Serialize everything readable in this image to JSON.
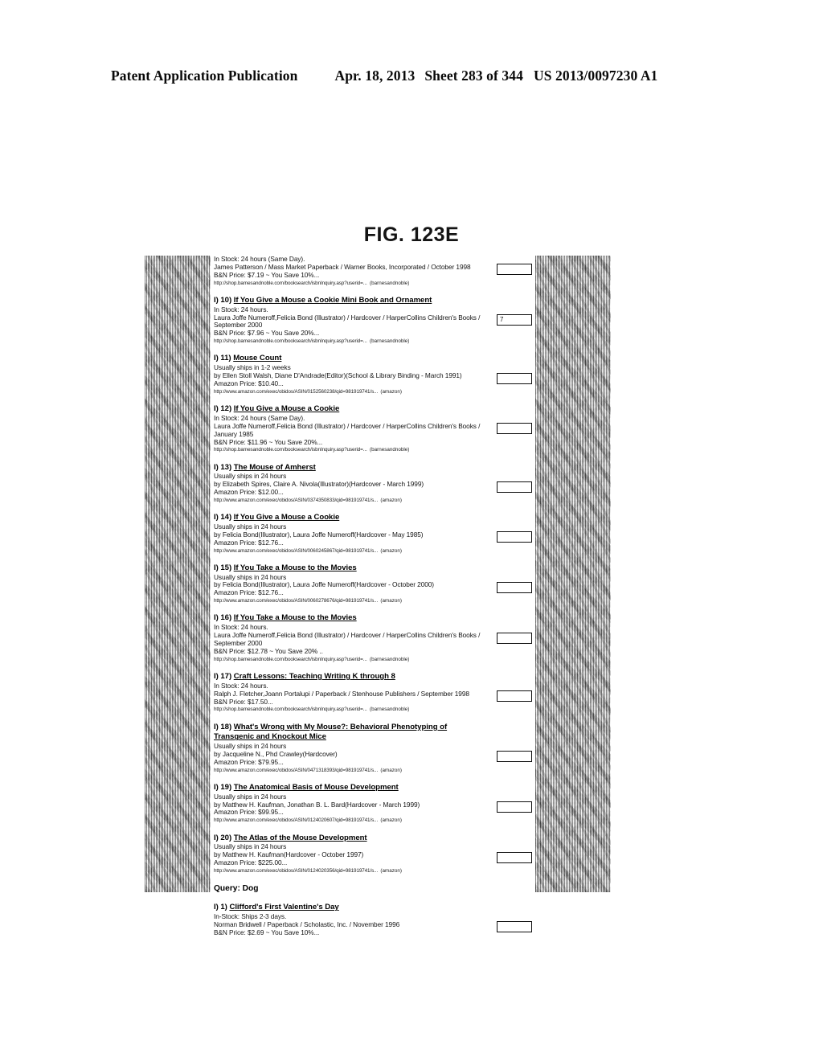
{
  "header": {
    "publication": "Patent Application Publication",
    "date": "Apr. 18, 2013",
    "sheet": "Sheet 283 of 344",
    "patent_number": "US 2013/0097230 A1"
  },
  "figure": {
    "caption": "FIG. 123E",
    "partial_top_entry": {
      "stock": "In Stock: 24 hours (Same Day).",
      "detail": "James Patterson / Mass Market Paperback / Warner Books, Incorporated / October 1998",
      "price": "B&N Price: $7.19 ~ You Save 10%...",
      "url": "http://shop.barnesandnoble.com/booksearch/isbnInquiry.asp?userid=...",
      "source": "(barnesandnoble)"
    },
    "entries": [
      {
        "num": "I) 10)",
        "title": "If You Give a Mouse a Cookie Mini Book and Ornament",
        "stock": "In Stock: 24 hours.",
        "detail": "Laura Joffe Numeroff,Felicia Bond (Illustrator) / Hardcover / HarperCollins Children's Books /",
        "detail2": "September 2000",
        "price": "B&N Price: $7.96 ~ You Save 20%...",
        "url": "http://shop.barnesandnoble.com/booksearch/isbnInquiry.asp?userid=...",
        "source": "(barnesandnoble)",
        "box_label": "7"
      },
      {
        "num": "I) 11)",
        "title": "Mouse Count",
        "stock": "Usually ships in 1-2 weeks",
        "detail": "by Ellen Stoll Walsh, Diane D'Andrade(Editor)(School & Library Binding - March 1991)",
        "price": "Amazon Price: $10.40...",
        "url": "http://www.amazon.com/exec/obidos/ASIN/0152560238/qid=981919741/s...",
        "source": "(amazon)",
        "box_label": ""
      },
      {
        "num": "I) 12)",
        "title": "If You Give a Mouse a Cookie",
        "stock": "In Stock: 24 hours (Same Day).",
        "detail": "Laura Joffe Numeroff,Felicia Bond (Illustrator) / Hardcover / HarperCollins Children's Books /",
        "detail2": "January 1985",
        "price": "B&N Price: $11.96 ~ You Save 20%...",
        "url": "http://shop.barnesandnoble.com/booksearch/isbnInquiry.asp?userid=...",
        "source": "(barnesandnoble)",
        "box_label": ""
      },
      {
        "num": "I) 13)",
        "title": "The Mouse of Amherst",
        "stock": "Usually ships in 24 hours",
        "detail": "by Elizabeth Spires, Claire A. Nivola(Illustrator)(Hardcover - March 1999)",
        "price": "Amazon Price: $12.00...",
        "url": "http://www.amazon.com/exec/obidos/ASIN/0374350833/qid=981919741/s...",
        "source": "(amazon)",
        "box_label": ""
      },
      {
        "num": "I) 14)",
        "title": "If You Give a Mouse a Cookie",
        "stock": "Usually ships in 24 hours",
        "detail": "by Felicia Bond(Illustrator), Laura Joffe Numeroff(Hardcover - May 1985)",
        "price": "Amazon Price: $12.76...",
        "url": "http://www.amazon.com/exec/obidos/ASIN/0060245867/qid=981919741/s...",
        "source": "(amazon)",
        "box_label": ""
      },
      {
        "num": "I) 15)",
        "title": "If You Take a Mouse to the Movies",
        "stock": "Usually ships in 24 hours",
        "detail": "by Felicia Bond(Illustrator), Laura Joffe Numeroff(Hardcover - October 2000)",
        "price": "Amazon Price: $12.76...",
        "url": "http://www.amazon.com/exec/obidos/ASIN/0060278676/qid=981919741/s...",
        "source": "(amazon)",
        "box_label": ""
      },
      {
        "num": "I) 16)",
        "title": "If You Take a Mouse to the Movies",
        "stock": "In Stock: 24 hours.",
        "detail": "Laura Joffe Numeroff,Felicia Bond (Illustrator) / Hardcover / HarperCollins Children's Books /",
        "detail2": "September 2000",
        "price": "B&N Price: $12.78 ~ You Save 20% ..",
        "url": "http://shop.barnesandnoble.com/booksearch/isbnInquiry.asp?userid=...",
        "source": "(barnesandnoble)",
        "box_label": ""
      },
      {
        "num": "I) 17)",
        "title": "Craft Lessons: Teaching Writing K through 8",
        "stock": "In Stock: 24 hours.",
        "detail": "Ralph J. Fletcher,Joann Portalupi / Paperback / Stenhouse Publishers / September 1998",
        "price": "B&N Price: $17.50...",
        "url": "http://shop.barnesandnoble.com/booksearch/isbnInquiry.asp?userid=...",
        "source": "(barnesandnoble)",
        "box_label": ""
      },
      {
        "num": "I) 18)",
        "title": "What's Wrong with My Mouse?: Behavioral Phenotyping of",
        "title2": "Transgenic and Knockout Mice",
        "stock": "Usually ships in 24 hours",
        "detail": "by Jacqueline N., Phd Crawley(Hardcover)",
        "price": "Amazon Price: $79.95...",
        "url": "http://www.amazon.com/exec/obidos/ASIN/0471318393/qid=981919741/s...",
        "source": "(amazon)",
        "box_label": ""
      },
      {
        "num": "I) 19)",
        "title": "The Anatomical Basis of Mouse Development",
        "stock": "Usually ships in 24 hours",
        "detail": "by Matthew H. Kaufman, Jonathan B. L. Bard(Hardcover - March 1999)",
        "price": "Amazon Price: $99.95...",
        "url": "http://www.amazon.com/exec/obidos/ASIN/0124020607/qid=981919741/s...",
        "source": "(amazon)",
        "box_label": ""
      },
      {
        "num": "I) 20)",
        "title": "The Atlas of the Mouse Development",
        "stock": "Usually ships in 24 hours",
        "detail": "by Matthew H. Kaufman(Hardcover - October 1997)",
        "price": "Amazon Price: $225.00...",
        "url": "http://www.amazon.com/exec/obidos/ASIN/0124020356/qid=981919741/s...",
        "source": "(amazon)",
        "box_label": ""
      }
    ],
    "query_heading": "Query: Dog",
    "query_entries": [
      {
        "num": "I) 1)",
        "title": "Clifford's First Valentine's Day",
        "stock": "In-Stock: Ships 2-3 days.",
        "detail": "Norman Bridwell / Paperback / Scholastic, Inc. / November 1996",
        "price": "B&N Price: $2.69 ~ You Save 10%...",
        "box_label": ""
      }
    ]
  }
}
